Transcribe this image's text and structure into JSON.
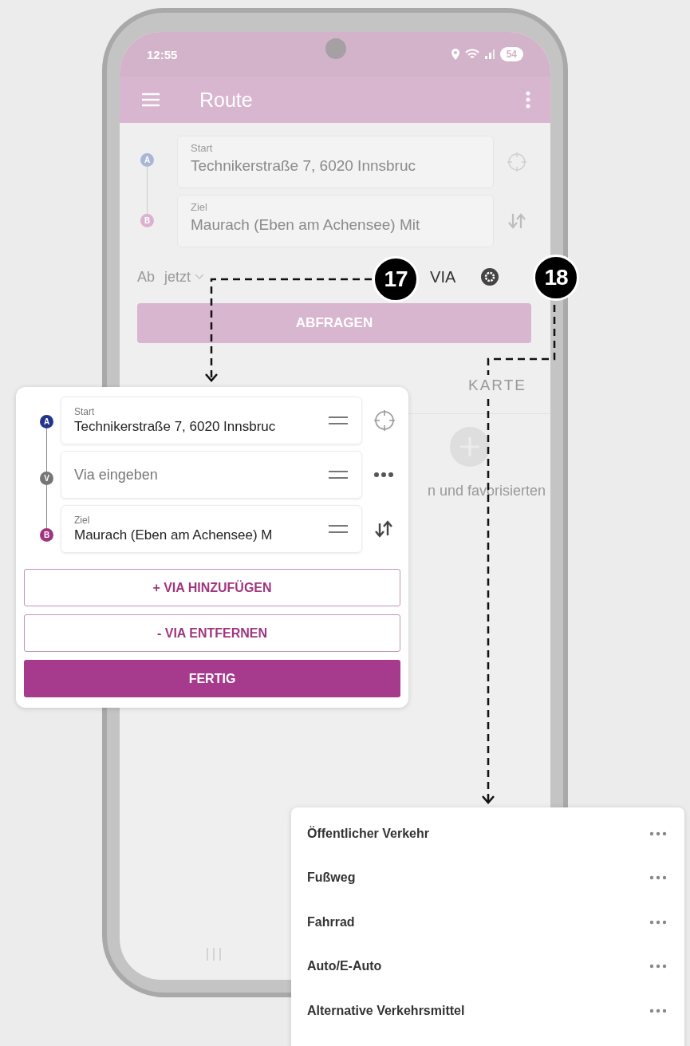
{
  "status_bar": {
    "time": "12:55",
    "battery": "54"
  },
  "app_bar": {
    "title": "Route"
  },
  "route_form": {
    "stops": [
      {
        "marker": "A",
        "color": "#a9b6d6",
        "label": "Start",
        "value": "Technikerstraße 7, 6020 Innsbruc",
        "kind": "start"
      },
      {
        "marker": "B",
        "color": "#dcb1cf",
        "label": "Ziel",
        "value": "Maurach (Eben am Achensee) Mit",
        "kind": "destination"
      }
    ],
    "departure_label": "Ab",
    "departure_value": "jetzt",
    "via_label": "VIA",
    "submit": "ABFRAGEN"
  },
  "tabs": [
    {
      "label": "KARTE",
      "selected": false
    }
  ],
  "empty_hint": "n und favorisierten",
  "via_popup": {
    "stops": [
      {
        "kind": "start",
        "marker": "A",
        "color": "#22358a",
        "label": "Start",
        "value": "Technikerstraße 7, 6020 Innsbruc"
      },
      {
        "kind": "via",
        "marker": "V",
        "color": "#767676",
        "placeholder": "Via eingeben"
      },
      {
        "kind": "destination",
        "marker": "B",
        "color": "#a0357f",
        "label": "Ziel",
        "value": "Maurach (Eben am Achensee) M"
      }
    ],
    "buttons": [
      {
        "kind": "outline",
        "label": "+ VIA HINZUFÜGEN"
      },
      {
        "kind": "outline",
        "label": "- VIA ENTFERNEN"
      },
      {
        "kind": "filled",
        "label": "FERTIG"
      }
    ]
  },
  "mode_menu": {
    "items": [
      {
        "label": "Öffentlicher Verkehr"
      },
      {
        "label": "Fußweg"
      },
      {
        "label": "Fahrrad"
      },
      {
        "label": "Auto/E-Auto"
      },
      {
        "label": "Alternative Verkehrsmittel"
      }
    ]
  },
  "callouts": [
    {
      "number": "17"
    },
    {
      "number": "18"
    }
  ]
}
